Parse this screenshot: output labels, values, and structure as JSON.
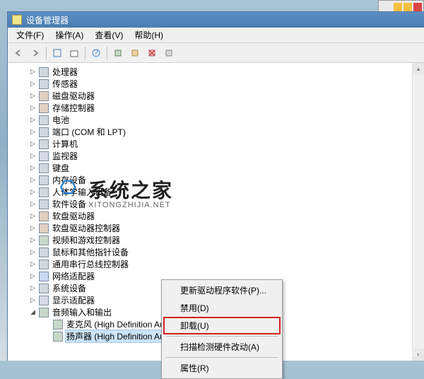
{
  "window": {
    "title": "设备管理器"
  },
  "menu": {
    "file": "文件(F)",
    "action": "操作(A)",
    "view": "查看(V)",
    "help": "帮助(H)"
  },
  "tree": {
    "items": [
      {
        "label": "处理器",
        "expander": "▷",
        "indent": 24,
        "iconCls": ""
      },
      {
        "label": "传感器",
        "expander": "▷",
        "indent": 24,
        "iconCls": ""
      },
      {
        "label": "磁盘驱动器",
        "expander": "▷",
        "indent": 24,
        "iconCls": "disk"
      },
      {
        "label": "存储控制器",
        "expander": "▷",
        "indent": 24,
        "iconCls": "disk"
      },
      {
        "label": "电池",
        "expander": "▷",
        "indent": 24,
        "iconCls": ""
      },
      {
        "label": "端口 (COM 和 LPT)",
        "expander": "▷",
        "indent": 24,
        "iconCls": ""
      },
      {
        "label": "计算机",
        "expander": "▷",
        "indent": 24,
        "iconCls": ""
      },
      {
        "label": "监视器",
        "expander": "▷",
        "indent": 24,
        "iconCls": "monitor"
      },
      {
        "label": "键盘",
        "expander": "▷",
        "indent": 24,
        "iconCls": ""
      },
      {
        "label": "内存设备",
        "expander": "▷",
        "indent": 24,
        "iconCls": ""
      },
      {
        "label": "人体学输入设备",
        "expander": "▷",
        "indent": 24,
        "iconCls": ""
      },
      {
        "label": "软件设备",
        "expander": "▷",
        "indent": 24,
        "iconCls": ""
      },
      {
        "label": "软盘驱动器",
        "expander": "▷",
        "indent": 24,
        "iconCls": "disk"
      },
      {
        "label": "软盘驱动器控制器",
        "expander": "▷",
        "indent": 24,
        "iconCls": "disk"
      },
      {
        "label": "视频和游戏控制器",
        "expander": "▷",
        "indent": 24,
        "iconCls": "audio"
      },
      {
        "label": "鼠标和其他指针设备",
        "expander": "▷",
        "indent": 24,
        "iconCls": ""
      },
      {
        "label": "通用串行总线控制器",
        "expander": "▷",
        "indent": 24,
        "iconCls": ""
      },
      {
        "label": "网络适配器",
        "expander": "▷",
        "indent": 24,
        "iconCls": "net"
      },
      {
        "label": "系统设备",
        "expander": "▷",
        "indent": 24,
        "iconCls": ""
      },
      {
        "label": "显示适配器",
        "expander": "▷",
        "indent": 24,
        "iconCls": "monitor"
      },
      {
        "label": "音频输入和输出",
        "expander": "◢",
        "indent": 24,
        "iconCls": "audio"
      },
      {
        "label": "麦克风 (High Definition Audio 设备)",
        "expander": "",
        "indent": 44,
        "iconCls": "audio"
      },
      {
        "label": "扬声器 (High Definition Audio 设备)",
        "expander": "",
        "indent": 44,
        "iconCls": "audio",
        "selected": true
      }
    ]
  },
  "contextMenu": {
    "updateDriver": "更新驱动程序软件(P)...",
    "disable": "禁用(D)",
    "uninstall": "卸载(U)",
    "scanHardware": "扫描检测硬件改动(A)",
    "properties": "属性(R)"
  },
  "watermark": {
    "main": "系统之家",
    "sub": "XITONGZHIJIA.NET"
  },
  "footer": {
    "winver": "Windows 10 En"
  }
}
